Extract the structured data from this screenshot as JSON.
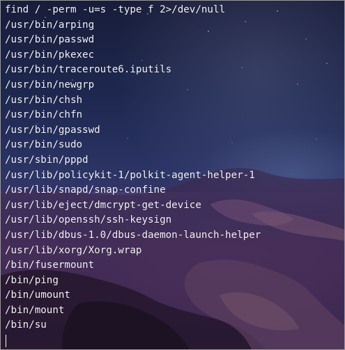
{
  "terminal": {
    "lines": [
      "find / -perm -u=s -type f 2>/dev/null",
      "/usr/bin/arping",
      "/usr/bin/passwd",
      "/usr/bin/pkexec",
      "/usr/bin/traceroute6.iputils",
      "/usr/bin/newgrp",
      "/usr/bin/chsh",
      "/usr/bin/chfn",
      "/usr/bin/gpasswd",
      "/usr/bin/sudo",
      "/usr/sbin/pppd",
      "/usr/lib/policykit-1/polkit-agent-helper-1",
      "/usr/lib/snapd/snap-confine",
      "/usr/lib/eject/dmcrypt-get-device",
      "/usr/lib/openssh/ssh-keysign",
      "/usr/lib/dbus-1.0/dbus-daemon-launch-helper",
      "/usr/lib/xorg/Xorg.wrap",
      "/bin/fusermount",
      "/bin/ping",
      "/bin/umount",
      "/bin/mount",
      "/bin/su"
    ]
  },
  "colors": {
    "text": "#f1f1f4",
    "background": "#2c3565",
    "border": "#9a9a9a"
  }
}
